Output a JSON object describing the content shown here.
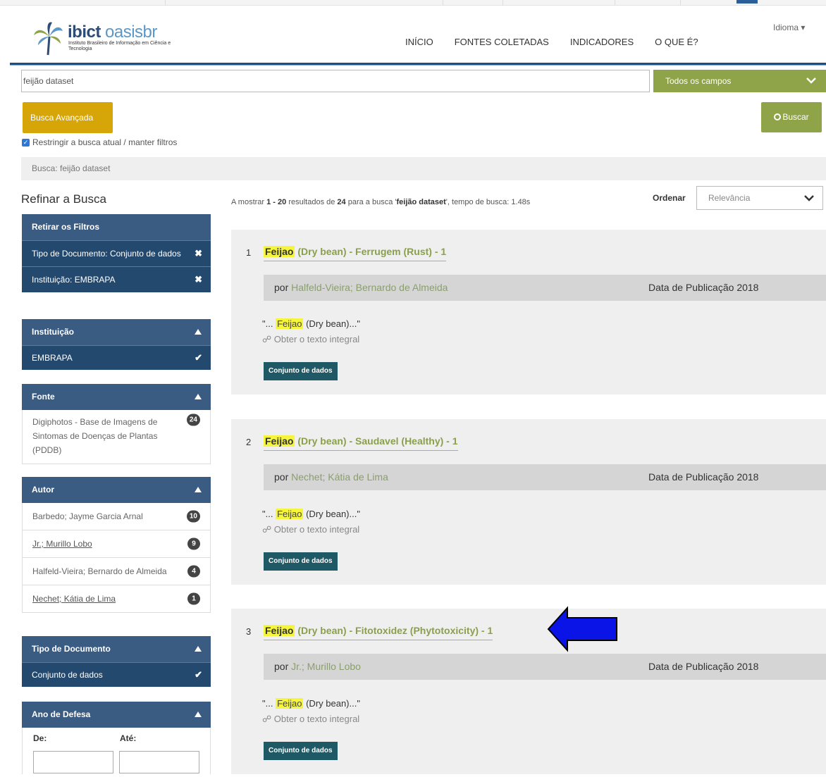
{
  "header": {
    "logo_main": "ibict",
    "logo_accent": "oasisbr",
    "logo_sub": "Instituto Brasileiro de Informação em Ciência e Tecnologia",
    "nav": [
      "INÍCIO",
      "FONTES COLETADAS",
      "INDICADORES",
      "O QUE É?"
    ],
    "language": "Idioma ▾"
  },
  "search": {
    "query": "feijão dataset",
    "field_select": "Todos os campos",
    "advanced_label": "Busca Avançada",
    "search_label": "Buscar",
    "restrict_label": "Restringir a busca atual / manter filtros",
    "breadcrumb": "Busca: feijão dataset"
  },
  "sidebar": {
    "title": "Refinar a Busca",
    "active_filters": {
      "header": "Retirar os Filtros",
      "items": [
        "Tipo de Documento: Conjunto de dados",
        "Instituição: EMBRAPA"
      ]
    },
    "institution": {
      "header": "Instituição",
      "items": [
        "EMBRAPA"
      ]
    },
    "source": {
      "header": "Fonte",
      "items": [
        {
          "label": "Digiphotos - Base de Imagens de Sintomas de Doenças de Plantas (PDDB)",
          "count": "24"
        }
      ]
    },
    "author": {
      "header": "Autor",
      "items": [
        {
          "label": "Barbedo; Jayme Garcia Arnal",
          "count": "10"
        },
        {
          "label": "Jr.; Murillo Lobo",
          "count": "9"
        },
        {
          "label": "Halfeld-Vieira; Bernardo de Almeida",
          "count": "4"
        },
        {
          "label": "Nechet; Kátia de Lima",
          "count": "1"
        }
      ]
    },
    "doctype": {
      "header": "Tipo de Documento",
      "items": [
        "Conjunto de dados"
      ]
    },
    "year": {
      "header": "Ano de Defesa",
      "from_label": "De:",
      "to_label": "Até:"
    }
  },
  "results": {
    "info_prefix": "A mostrar ",
    "range": "1 - 20",
    "info_mid": " resultados de ",
    "total": "24",
    "info_mid2": " para a busca '",
    "query": "feijão dataset",
    "info_suffix": "', tempo de busca: 1.48s",
    "sort_label": "Ordenar",
    "sort_value": "Relevância",
    "by_label": "por",
    "date_label": "Data de Publicação",
    "fulltext_label": "Obter o texto integral",
    "items": [
      {
        "num": "1",
        "title_hl": "Feijao",
        "title_rest": "(Dry bean) - Ferrugem (Rust) - 1",
        "author": "Halfeld-Vieira; Bernardo de Almeida",
        "year": "2018",
        "snippet_pre": "\"... ",
        "snippet_hl": "Feijao",
        "snippet_post": " (Dry bean)...\"",
        "tag": "Conjunto de dados"
      },
      {
        "num": "2",
        "title_hl": "Feijao",
        "title_rest": "(Dry bean) - Saudavel (Healthy) - 1",
        "author": "Nechet; Kátia de Lima",
        "year": "2018",
        "snippet_pre": "\"... ",
        "snippet_hl": "Feijao",
        "snippet_post": " (Dry bean)...\"",
        "tag": "Conjunto de dados"
      },
      {
        "num": "3",
        "title_hl": "Feijao",
        "title_rest": "(Dry bean) - Fitotoxidez (Phytotoxicity) - 1",
        "author": "Jr.; Murillo Lobo",
        "year": "2018",
        "snippet_pre": "\"... ",
        "snippet_hl": "Feijao",
        "snippet_post": " (Dry bean)...\"",
        "tag": "Conjunto de dados"
      }
    ]
  },
  "colors": {
    "accent_green": "#8fa448",
    "accent_gold": "#d6a608",
    "sidebar_blue": "#3a5c82",
    "arrow_blue": "#0a14e6"
  }
}
